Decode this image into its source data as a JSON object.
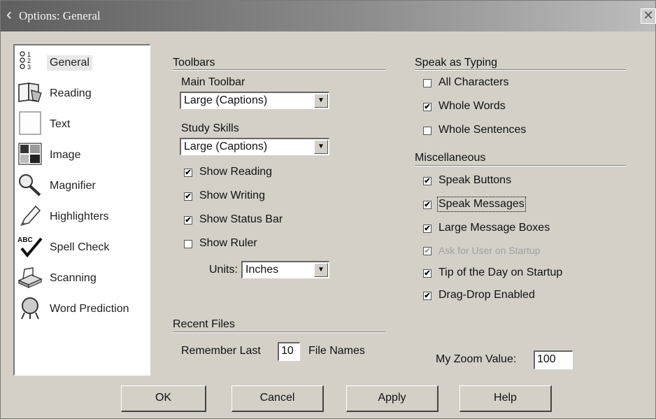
{
  "window": {
    "title": "Options: General"
  },
  "sidebar": {
    "items": [
      {
        "label": "General",
        "icon": "general-icon"
      },
      {
        "label": "Reading",
        "icon": "reading-icon"
      },
      {
        "label": "Text",
        "icon": "text-icon"
      },
      {
        "label": "Image",
        "icon": "image-icon"
      },
      {
        "label": "Magnifier",
        "icon": "magnifier-icon"
      },
      {
        "label": "Highlighters",
        "icon": "highlighter-icon"
      },
      {
        "label": "Spell Check",
        "icon": "spell-check-icon"
      },
      {
        "label": "Scanning",
        "icon": "scanner-icon"
      },
      {
        "label": "Word Prediction",
        "icon": "word-prediction-icon"
      }
    ],
    "selected": "General"
  },
  "toolbars": {
    "title": "Toolbars",
    "main_label": "Main Toolbar",
    "main_value": "Large (Captions)",
    "study_label": "Study Skills",
    "study_value": "Large (Captions)",
    "show_reading": "Show Reading",
    "show_writing": "Show Writing",
    "show_status_bar": "Show Status Bar",
    "show_ruler": "Show Ruler",
    "units_label": "Units:",
    "units_value": "Inches"
  },
  "recent_files": {
    "title": "Recent Files",
    "remember_label": "Remember Last",
    "count": "10",
    "suffix": "File Names"
  },
  "speak_as_typing": {
    "title": "Speak as Typing",
    "all_characters": "All Characters",
    "whole_words": "Whole Words",
    "whole_sentences": "Whole Sentences"
  },
  "misc": {
    "title": "Miscellaneous",
    "speak_buttons": "Speak Buttons",
    "speak_messages": "Speak Messages",
    "large_message_boxes": "Large Message Boxes",
    "ask_for_user": "Ask for User on Startup",
    "tip_of_day": "Tip of the Day on Startup",
    "drag_drop": "Drag-Drop Enabled"
  },
  "zoom": {
    "label": "My Zoom Value:",
    "value": "100"
  },
  "buttons": {
    "ok": "OK",
    "cancel": "Cancel",
    "apply": "Apply",
    "help": "Help"
  },
  "checked_glyph": "✔"
}
